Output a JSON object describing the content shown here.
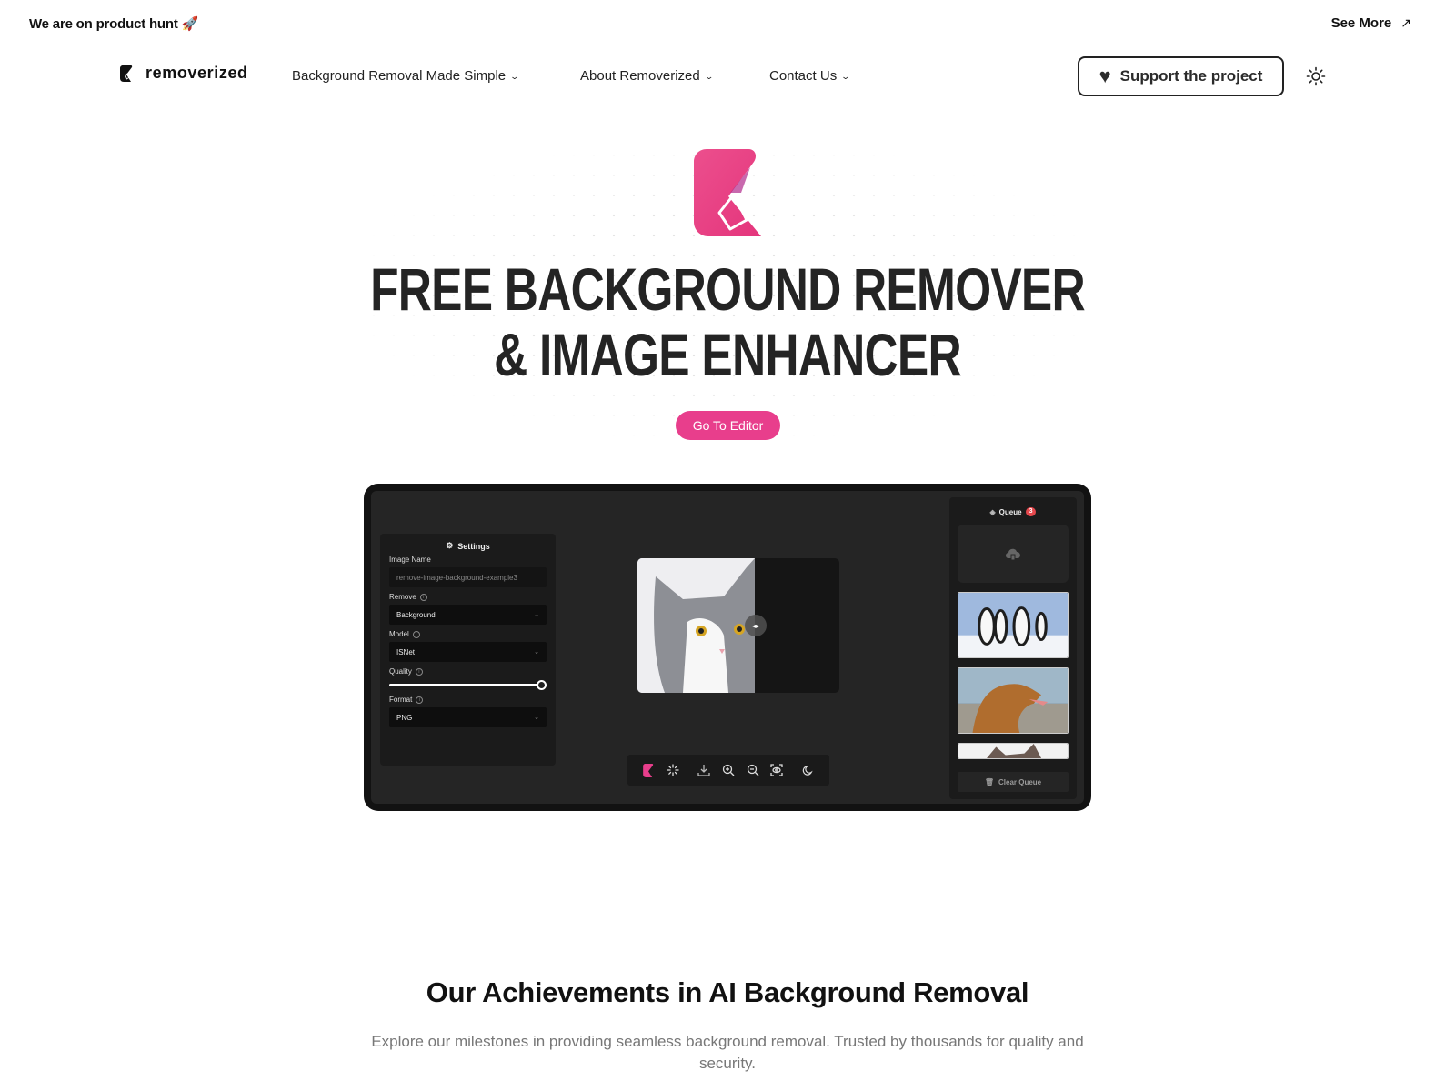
{
  "topbar": {
    "announcement": "We are on product hunt 🚀",
    "see_more": "See More",
    "see_more_icon": "arrow-up-right-icon"
  },
  "nav": {
    "brand": "removerized",
    "items": [
      {
        "label": "Background Removal Made Simple"
      },
      {
        "label": "About Removerized"
      },
      {
        "label": "Contact Us"
      }
    ],
    "support_label": "Support the project",
    "theme_icon": "sun-icon"
  },
  "hero": {
    "title_line1": "FREE BACKGROUND REMOVER",
    "title_line2": "& IMAGE ENHANCER",
    "cta": "Go To Editor"
  },
  "editor": {
    "settings": {
      "title": "Settings",
      "image_name_label": "Image Name",
      "image_name_value": "remove-image-background-example3",
      "remove_label": "Remove",
      "remove_value": "Background",
      "model_label": "Model",
      "model_value": "ISNet",
      "quality_label": "Quality",
      "quality_value": 1.0,
      "format_label": "Format",
      "format_value": "PNG"
    },
    "toolbar": [
      "logo-icon",
      "loader-icon",
      "download-icon",
      "zoom-in-icon",
      "zoom-out-icon",
      "focus-icon",
      "moon-icon"
    ],
    "queue": {
      "title": "Queue",
      "count": "3",
      "items": [
        "penguins",
        "golden-retriever",
        "cat"
      ],
      "clear_label": "Clear Queue"
    }
  },
  "achievements": {
    "title": "Our Achievements in AI Background Removal",
    "subtitle": "Explore our milestones in providing seamless background removal. Trusted by thousands for quality and security."
  },
  "colors": {
    "accent": "#e83e8c",
    "dark": "#121212",
    "badge": "#e5484d"
  }
}
